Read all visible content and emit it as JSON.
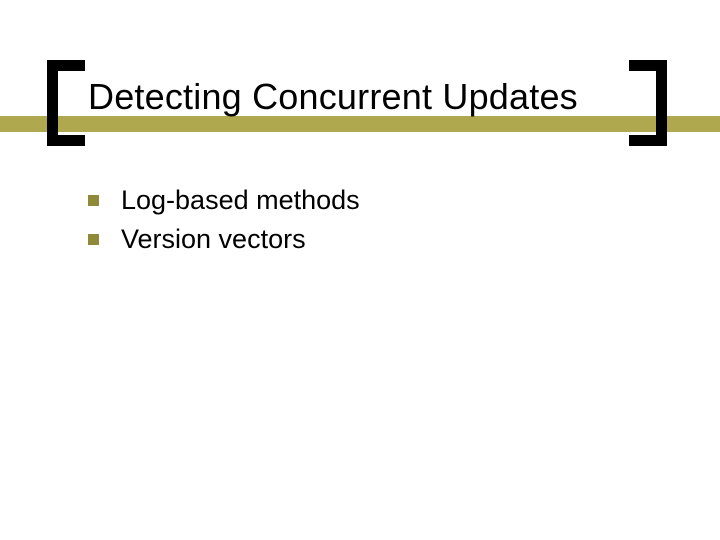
{
  "title": "Detecting Concurrent Updates",
  "bullets": [
    "Log-based methods",
    "Version vectors"
  ]
}
